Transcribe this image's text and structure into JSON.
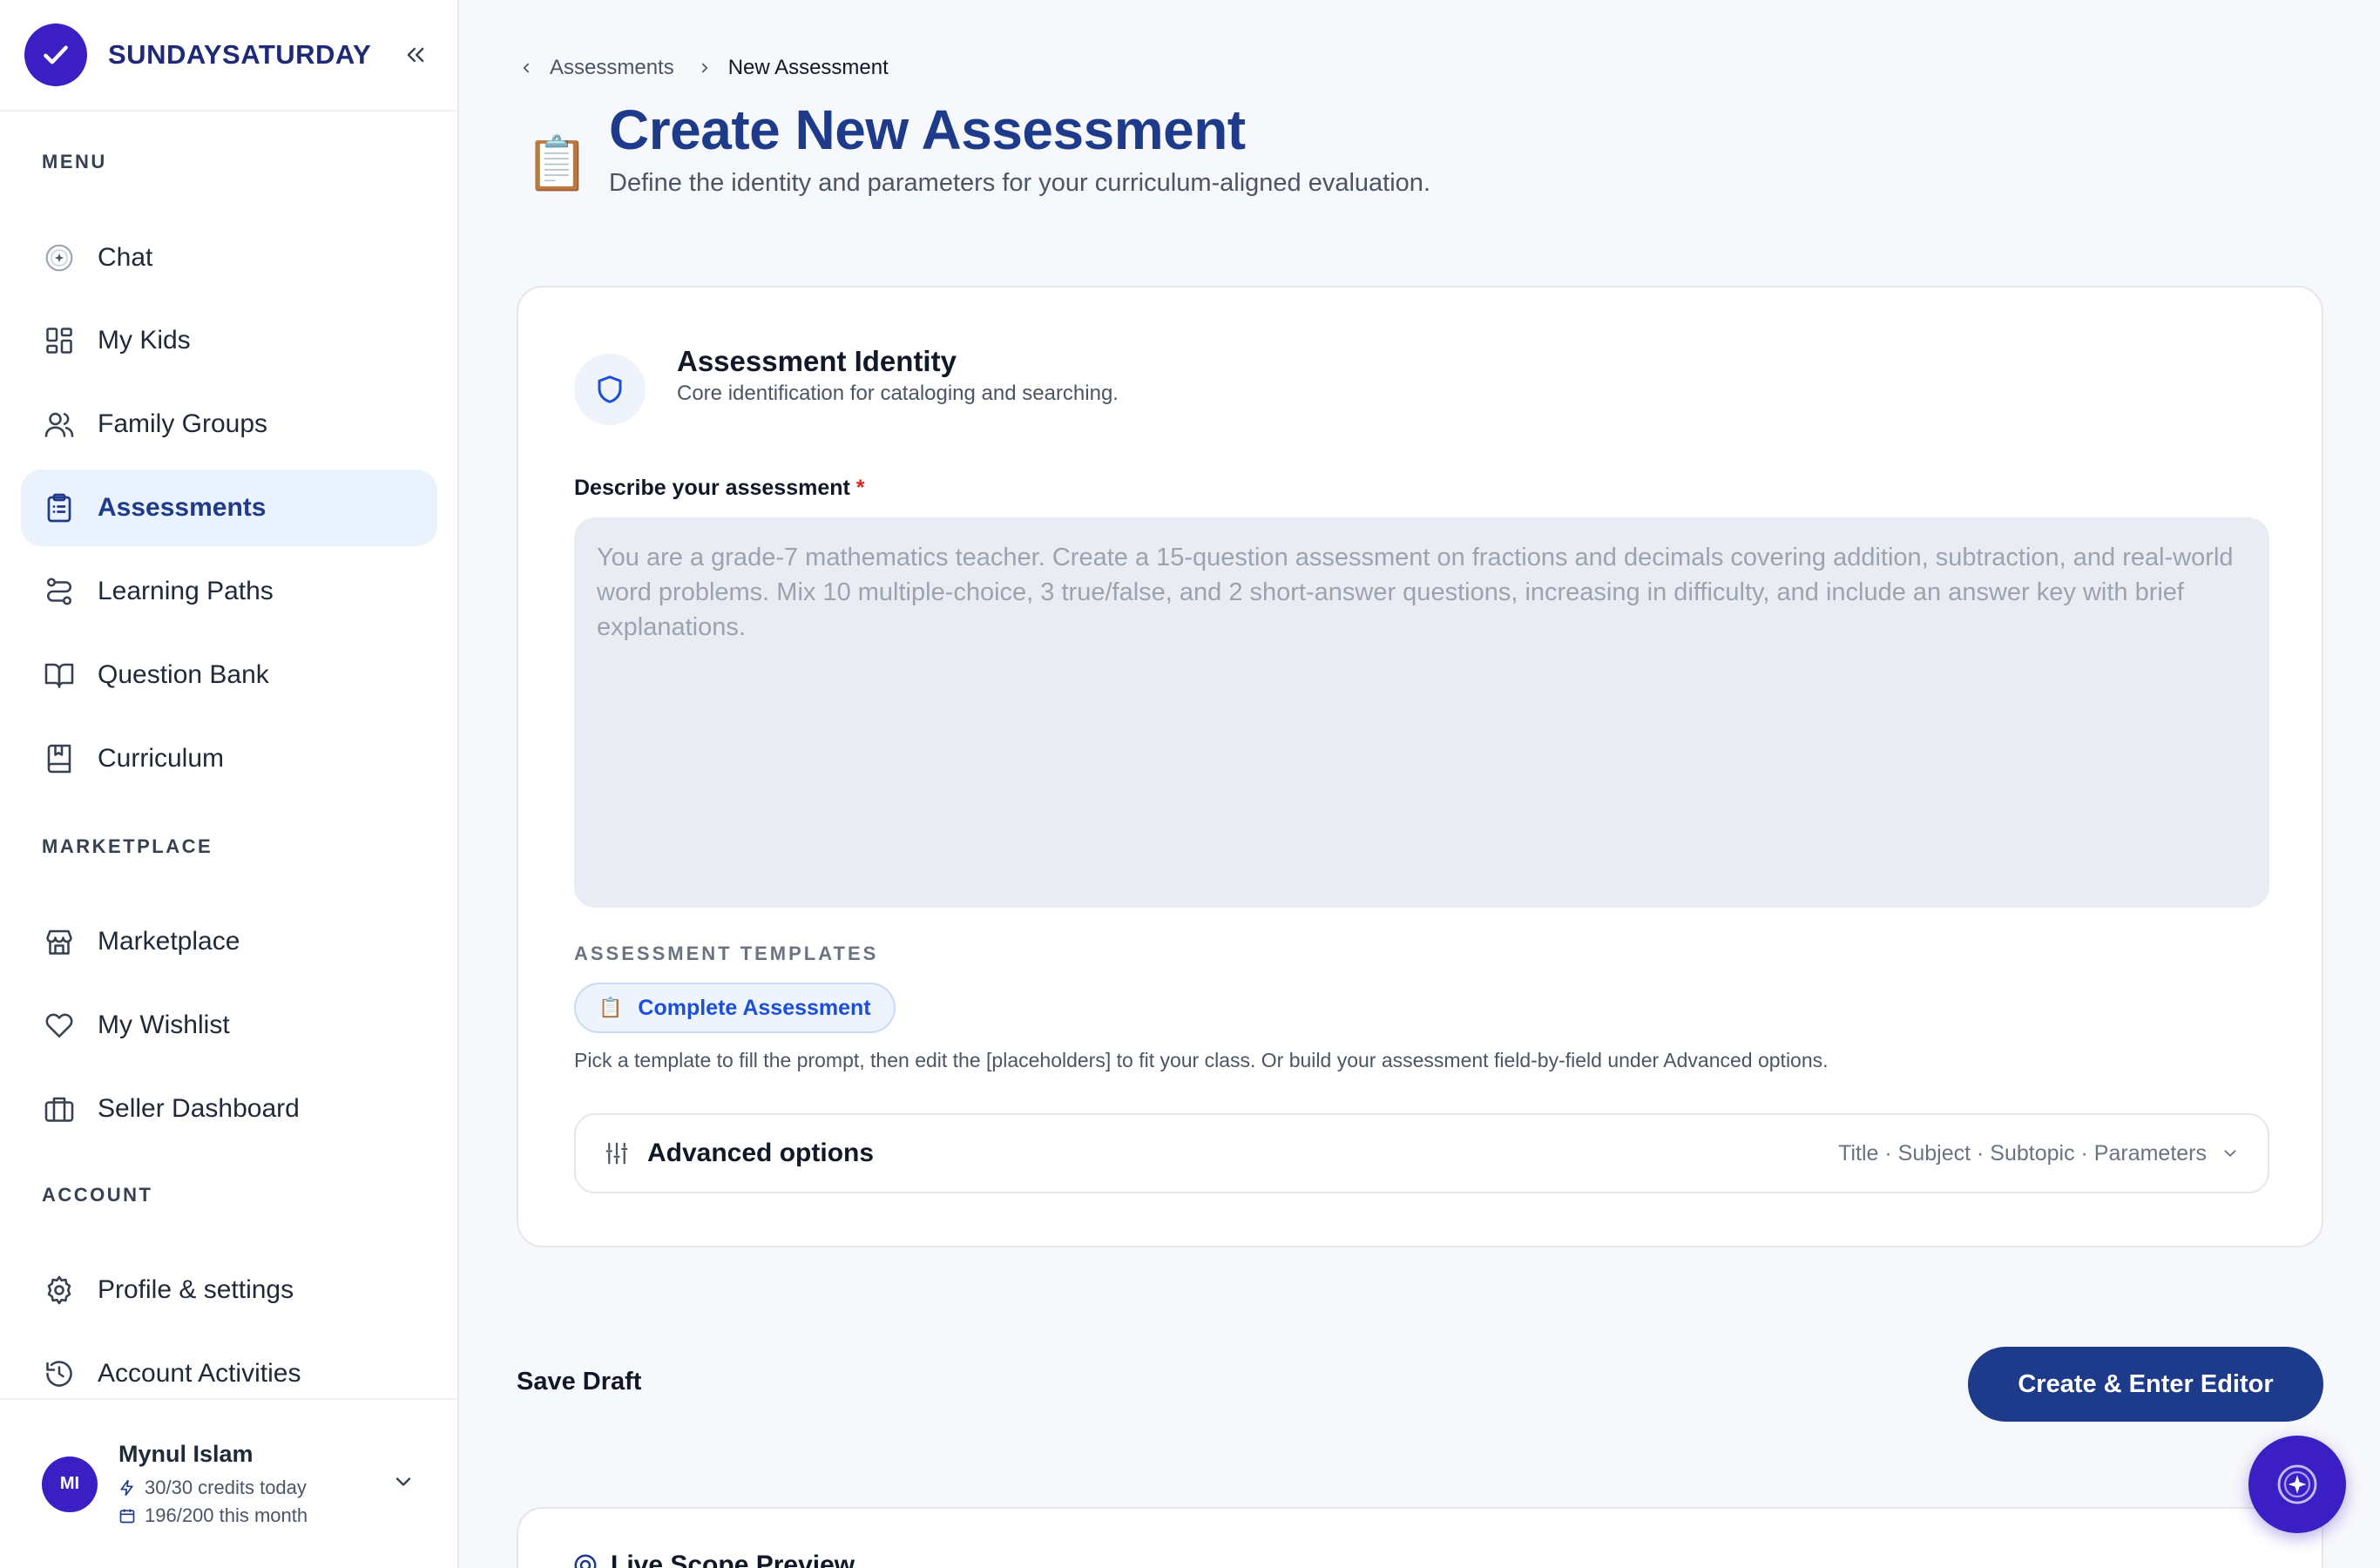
{
  "brand": {
    "name": "SUNDAYSATURDAY"
  },
  "sidebar": {
    "sections": {
      "menu": "MENU",
      "marketplace": "MARKETPLACE",
      "account": "ACCOUNT"
    },
    "menu_items": [
      {
        "label": "Chat",
        "icon": "sparkle-circle-icon"
      },
      {
        "label": "My Kids",
        "icon": "grid-icon"
      },
      {
        "label": "Family Groups",
        "icon": "users-icon"
      },
      {
        "label": "Assessments",
        "icon": "clipboard-icon",
        "active": true
      },
      {
        "label": "Learning Paths",
        "icon": "route-icon"
      },
      {
        "label": "Question Bank",
        "icon": "book-open-icon"
      },
      {
        "label": "Curriculum",
        "icon": "book-icon"
      }
    ],
    "marketplace_items": [
      {
        "label": "Marketplace",
        "icon": "store-icon"
      },
      {
        "label": "My Wishlist",
        "icon": "heart-icon"
      },
      {
        "label": "Seller Dashboard",
        "icon": "briefcase-icon"
      }
    ],
    "account_items": [
      {
        "label": "Profile & settings",
        "icon": "gear-icon"
      },
      {
        "label": "Account Activities",
        "icon": "history-icon"
      }
    ]
  },
  "user": {
    "initials": "MI",
    "name": "Mynul Islam",
    "credits_today": "30/30 credits today",
    "credits_month": "196/200 this month"
  },
  "breadcrumb": {
    "parent": "Assessments",
    "current": "New Assessment"
  },
  "page": {
    "icon": "📋",
    "title": "Create New Assessment",
    "subtitle": "Define the identity and parameters for your curriculum-aligned evaluation."
  },
  "identity": {
    "title": "Assessment Identity",
    "subtitle": "Core identification for cataloging and searching."
  },
  "form": {
    "describe_label": "Describe your assessment",
    "required_mark": "*",
    "placeholder": "You are a grade-7 mathematics teacher. Create a 15-question assessment on fractions and decimals covering addition, subtraction, and real-world word problems. Mix 10 multiple-choice, 3 true/false, and 2 short-answer questions, increasing in difficulty, and include an answer key with brief explanations.",
    "value": ""
  },
  "templates": {
    "label": "ASSESSMENT TEMPLATES",
    "chip_icon": "📋",
    "chip_label": "Complete Assessment",
    "help": "Pick a template to fill the prompt, then edit the [placeholders] to fit your class. Or build your assessment field-by-field under Advanced options."
  },
  "advanced": {
    "title": "Advanced options",
    "meta": "Title · Subject · Subtopic · Parameters"
  },
  "actions": {
    "save_draft": "Save Draft",
    "create": "Create & Enter Editor"
  },
  "preview": {
    "title": "Live Scope Preview"
  },
  "colors": {
    "brand": "#3b1fc4",
    "primary": "#1e3a8a",
    "active_bg": "#eaf2fd",
    "chip_text": "#1d4ed8"
  }
}
